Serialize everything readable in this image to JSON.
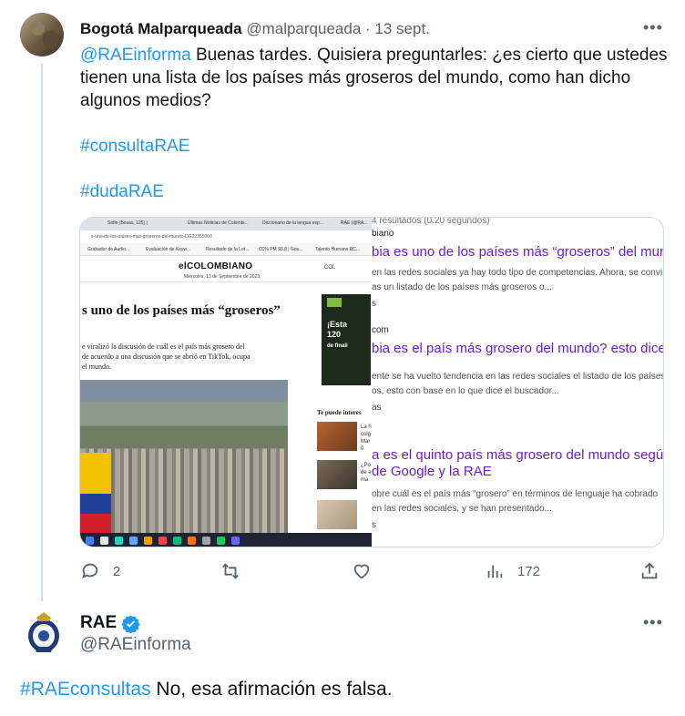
{
  "tweet1": {
    "author_name": "Bogotá Malparqueada",
    "author_handle": "@malparqueada",
    "separator": "·",
    "date": "13 sept.",
    "more": "•••",
    "mention": "@RAEinforma",
    "body_line1_rest": " Buenas tardes. Quisiera preguntarles: ¿es cierto que ustedes",
    "body_line2": "tienen una lista de los países más groseros del mundo, como han dicho",
    "body_line3": "algunos medios?",
    "hashtag1": "#consultaRAE",
    "hashtag2": "#dudaRAE",
    "actions": {
      "replies": "2",
      "retweets": "",
      "likes": "",
      "views": "172"
    }
  },
  "screenshot_left": {
    "tabs": [
      "Sofie (Bosas, 125) | ",
      "Últimas Noticias de Colombi...",
      "Diccionario de la lengua esp...",
      "RAE (@RA..."
    ],
    "url": "s-uno-de-los-paises-mas-groseros-del-mundo-DG22355060",
    "bookmarks": [
      "Grabador de Audio...",
      "Evaluación de Keyw...",
      "Resultado de la Lot...",
      "€C% PM 93.8 | Gou...",
      "Talento Humano RC..."
    ],
    "brand": "elCOLOMBIANO",
    "paper_date": "Miércoles, 13 de Septiembre de 2023",
    "col": "COL",
    "headline": "s uno de los países más “groseros”",
    "lead_line1": "e viralizó la discusión de cuál es el país más grosero del",
    "lead_line2": "de acuerdo a una discusión que se abrió en TikTok, ocupa",
    "lead_line3": "el mundo.",
    "ad_text1": "¡Esta",
    "ad_text2": "120",
    "ad_text3": "de finali",
    "related_label": "Te puede interes",
    "related1": [
      "La h",
      "colg",
      "Mar 0"
    ],
    "related2": [
      "¿Po",
      "de e",
      "ma"
    ]
  },
  "screenshot_right": {
    "results": "4 resultados (0.20 segundos)",
    "r1_site": "biano",
    "r1_title": "bia es uno de los países más “groseros” del mundo?",
    "r1_snip1": "en las redes sociales ya hay todo tipo de competencias. Ahora, se convirtió",
    "r1_snip2": "as un listado de los países más groseros o...",
    "r1_foot": "s",
    "r2_site": "com",
    "r2_title": "bia es el país más grosero del mundo? esto dice un",
    "r2_snip1": "ente se ha vuelto tendencia en las redes sociales el listado de los países",
    "r2_snip2": "os, esto con base en lo que dice el buscador...",
    "r2_foot": "as",
    "r3_title1": "a es el quinto país más grosero del mundo según",
    "r3_title2": "de Google y la RAE",
    "r3_snip1": "obre cuál es el país más “grosero” en términos de lenguaje ha cobrado",
    "r3_snip2": "en las redes sociales, y se han presentado...",
    "r3_foot": "s"
  },
  "tweet2": {
    "author_name": "RAE",
    "author_handle": "@RAEinforma",
    "more": "•••",
    "hashtag": "#RAEconsultas",
    "body": " No, esa afirmación es falsa."
  },
  "colors": {
    "link": "#1d9bf0",
    "text": "#0f1419",
    "muted": "#536471",
    "verified": "#1d9bf0",
    "visited_result": "#6a1fc4"
  }
}
